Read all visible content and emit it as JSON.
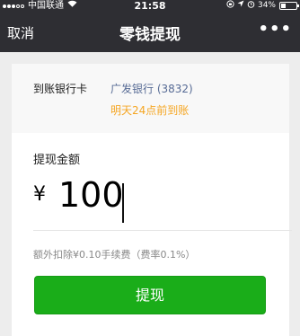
{
  "status_bar": {
    "carrier": "中国联通",
    "time": "21:58",
    "battery": "34%",
    "battery_level": 0.34
  },
  "nav": {
    "cancel_label": "取消",
    "title": "零钱提现",
    "more_label": "•••"
  },
  "destination": {
    "label": "到账银行卡",
    "bank": "广发银行 (3832)",
    "arrival_note": "明天24点前到账"
  },
  "amount": {
    "label": "提现金额",
    "currency_symbol": "¥",
    "value": "100"
  },
  "fee_note": "额外扣除¥0.10手续费（费率0.1%）",
  "withdraw_button_label": "提现",
  "colors": {
    "nav_background": "#2e2e33",
    "bank_link": "#576b95",
    "arrival_note": "#f5a623",
    "button_green": "#1aad19"
  }
}
